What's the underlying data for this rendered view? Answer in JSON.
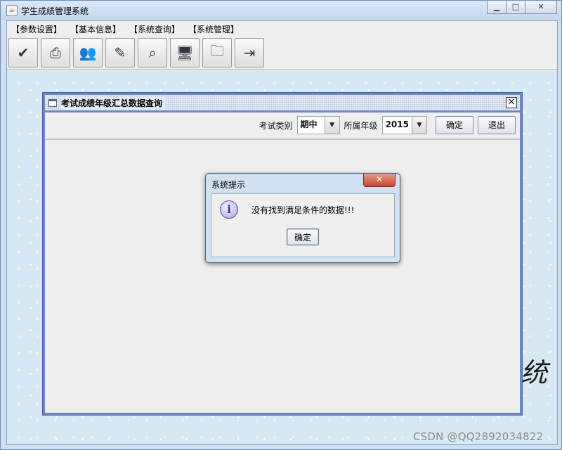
{
  "window": {
    "title": "学生成绩管理系统",
    "app_icon": "java-cup-icon",
    "controls": [
      "minimize-icon",
      "maximize-icon",
      "close-icon"
    ]
  },
  "menubar": {
    "items": [
      "【参数设置】",
      "【基本信息】",
      "【系统查询】",
      "【系统管理】"
    ]
  },
  "toolbar": {
    "buttons": [
      {
        "icon": "checklist-books-icon"
      },
      {
        "icon": "fax-icon"
      },
      {
        "icon": "people-icon"
      },
      {
        "icon": "tools-icon"
      },
      {
        "icon": "magnifier-icon"
      },
      {
        "icon": "computer-icon"
      },
      {
        "icon": "network-folder-icon"
      },
      {
        "icon": "exit-icon"
      }
    ]
  },
  "internal_frame": {
    "title": "考试成绩年级汇总数据查询",
    "exam_type_label": "考试类别",
    "exam_type_value": "期中",
    "grade_label": "所属年级",
    "grade_value": "2015",
    "confirm_label": "确定",
    "exit_label": "退出"
  },
  "dialog": {
    "title": "系统提示",
    "message": "没有找到满足条件的数据!!!",
    "ok_label": "确定"
  },
  "background": {
    "decoration": "统"
  },
  "watermark": "CSDN @QQ2892034822"
}
